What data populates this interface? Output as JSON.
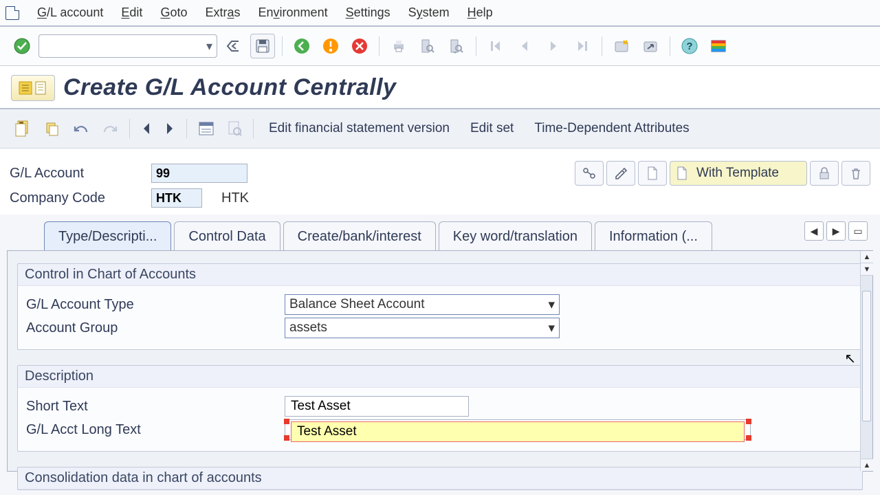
{
  "menu": {
    "items": [
      "G/L account",
      "Edit",
      "Goto",
      "Extras",
      "Environment",
      "Settings",
      "System",
      "Help"
    ]
  },
  "std_toolbar": {
    "command_value": ""
  },
  "page_title": "Create G/L Account Centrally",
  "app_toolbar": {
    "links": [
      "Edit financial statement version",
      "Edit set",
      "Time-Dependent Attributes"
    ]
  },
  "header": {
    "gl_label": "G/L Account",
    "gl_value": "99",
    "cc_label": "Company Code",
    "cc_value": "HTK",
    "cc_text": "HTK",
    "with_template": "With Template"
  },
  "tabs": [
    "Type/Descripti...",
    "Control Data",
    "Create/bank/interest",
    "Key word/translation",
    "Information (..."
  ],
  "groups": {
    "chart": {
      "title": "Control in Chart of Accounts",
      "rows": [
        {
          "label": "G/L Account Type",
          "value": "Balance Sheet Account"
        },
        {
          "label": "Account Group",
          "value": "assets"
        }
      ]
    },
    "desc": {
      "title": "Description",
      "short_label": "Short Text",
      "short_value": "Test Asset",
      "long_label": "G/L Acct Long Text",
      "long_value": "Test Asset"
    },
    "consol": {
      "title": "Consolidation data in chart of accounts"
    }
  }
}
